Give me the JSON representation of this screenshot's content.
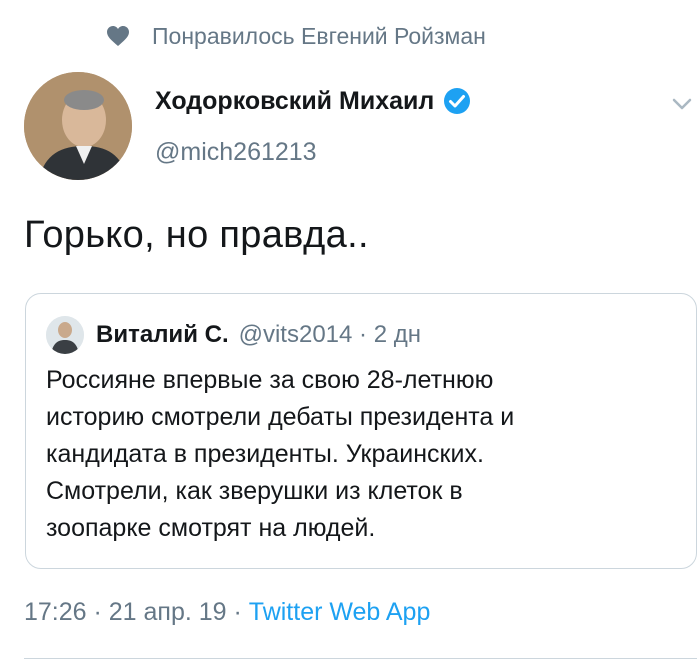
{
  "social_context": {
    "icon": "heart-icon",
    "text": "Понравилось Евгений Ройзман"
  },
  "author": {
    "name": "Ходорковский Михаил",
    "handle": "@mich261213",
    "verified_icon": "verified-badge-icon"
  },
  "tweet": {
    "text": "Горько, но правда.."
  },
  "quoted_tweet": {
    "name": "Виталий С.",
    "meta": "@vits2014 · 2 дн",
    "lines": [
      "Россияне впервые за свою 28-летнюю",
      "историю смотрели дебаты президента и",
      "кандидата в президенты. Украинских.",
      "Смотрели, как зверушки из клеток в",
      "зоопарке смотрят на людей."
    ]
  },
  "footer": {
    "timestamp": "17:26 · 21 апр. 19 · ",
    "source": "Twitter Web App"
  },
  "colors": {
    "accent": "#1da1f2",
    "secondary_text": "#657786",
    "border": "#ccd6dd"
  }
}
